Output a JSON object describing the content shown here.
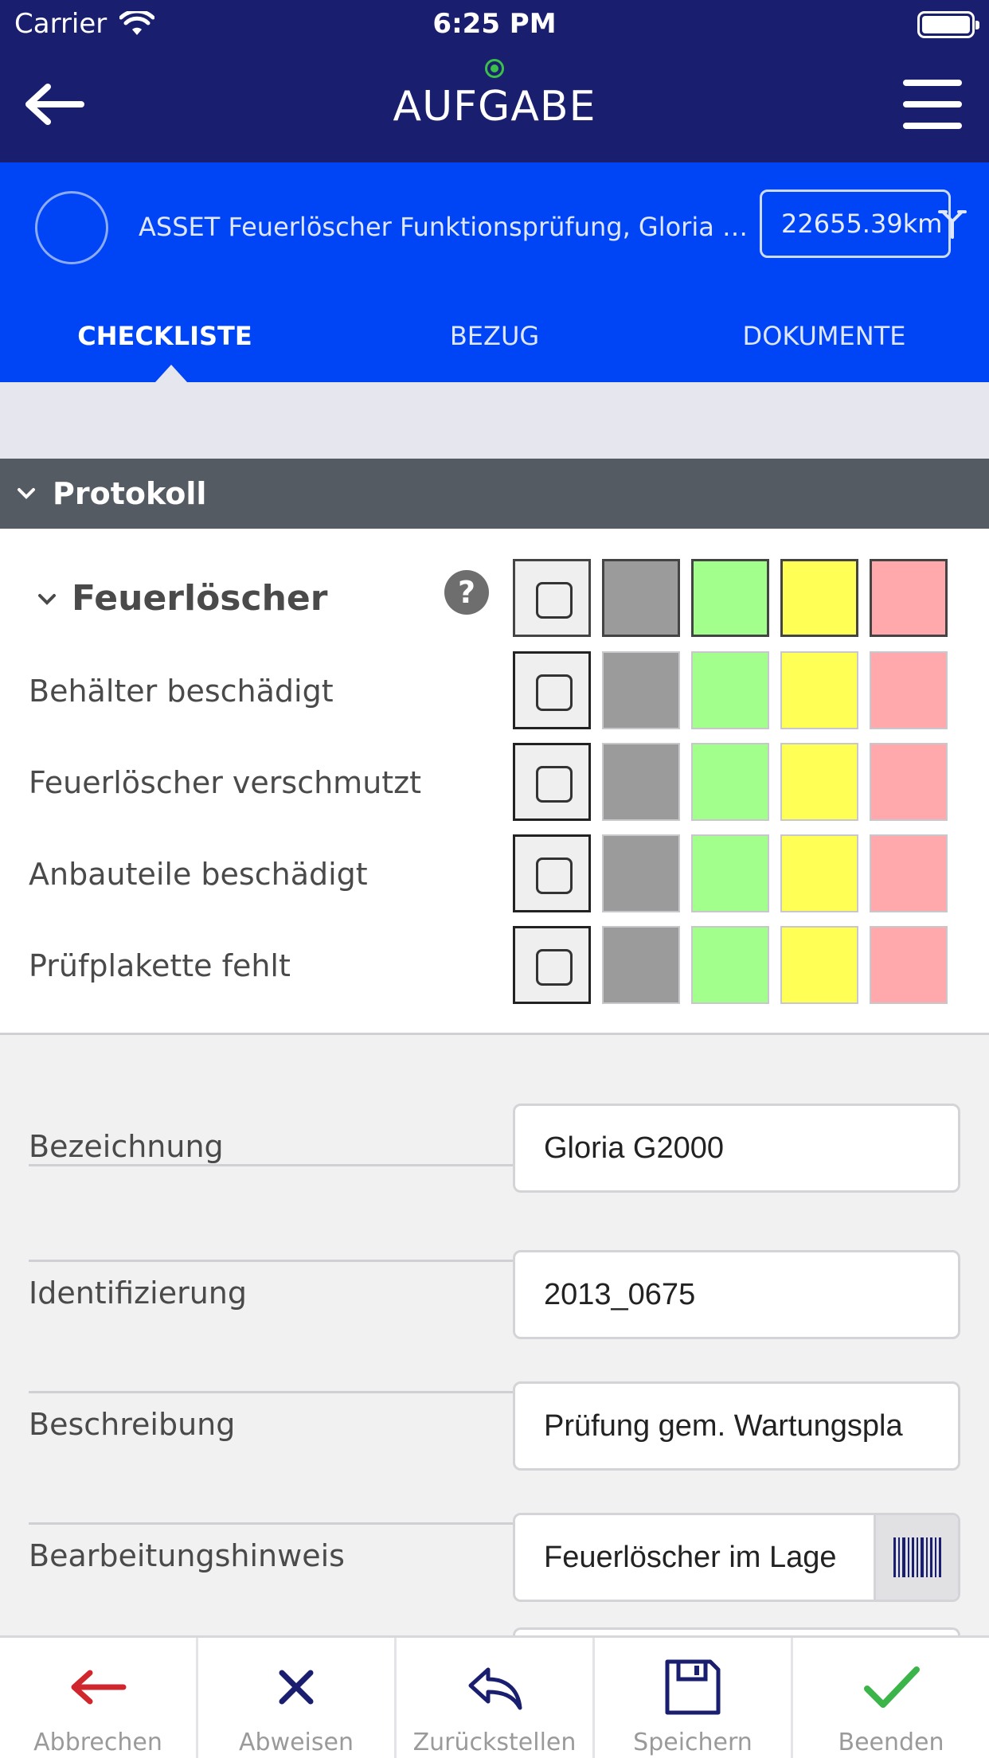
{
  "status_bar": {
    "carrier": "Carrier",
    "time": "6:25 PM"
  },
  "nav": {
    "title": "AUFGABE"
  },
  "asset": {
    "title": "ASSET Feuerlöscher Funktionsprüfung, Gloria G2...",
    "km": "22655.39km"
  },
  "tabs": [
    {
      "label": "CHECKLISTE",
      "active": true
    },
    {
      "label": "BEZUG",
      "active": false
    },
    {
      "label": "DOKUMENTE",
      "active": false
    }
  ],
  "section": {
    "title": "Protokoll"
  },
  "checklist": {
    "group_title": "Feuerlöscher",
    "help_symbol": "?",
    "status_colors": [
      "#9b9b9b",
      "#a3ff8c",
      "#ffff55",
      "#ffa9ad"
    ],
    "items": [
      {
        "label": "Behälter beschädigt"
      },
      {
        "label": "Feuerlöscher verschmutzt"
      },
      {
        "label": "Anbauteile beschädigt"
      },
      {
        "label": "Prüfplakette fehlt"
      }
    ]
  },
  "form": {
    "fields": [
      {
        "label": "Bezeichnung",
        "value": "Gloria G2000"
      },
      {
        "label": "Identifizierung",
        "value": "2013_0675"
      },
      {
        "label": "Beschreibung",
        "value": "Prüfung gem. Wartungspla"
      },
      {
        "label": "Bearbeitungshinweis",
        "value": "Feuerlöscher im Lage"
      }
    ]
  },
  "toolbar": {
    "cancel": "Abbrechen",
    "reject": "Abweisen",
    "defer": "Zurückstellen",
    "save": "Speichern",
    "finish": "Beenden"
  },
  "colors": {
    "nav_bg": "#1a1e6e",
    "header_bg": "#0045f5",
    "section_bg": "#555b62",
    "cancel": "#d0262e",
    "reject": "#1a1e6e",
    "finish": "#3bb54a"
  }
}
